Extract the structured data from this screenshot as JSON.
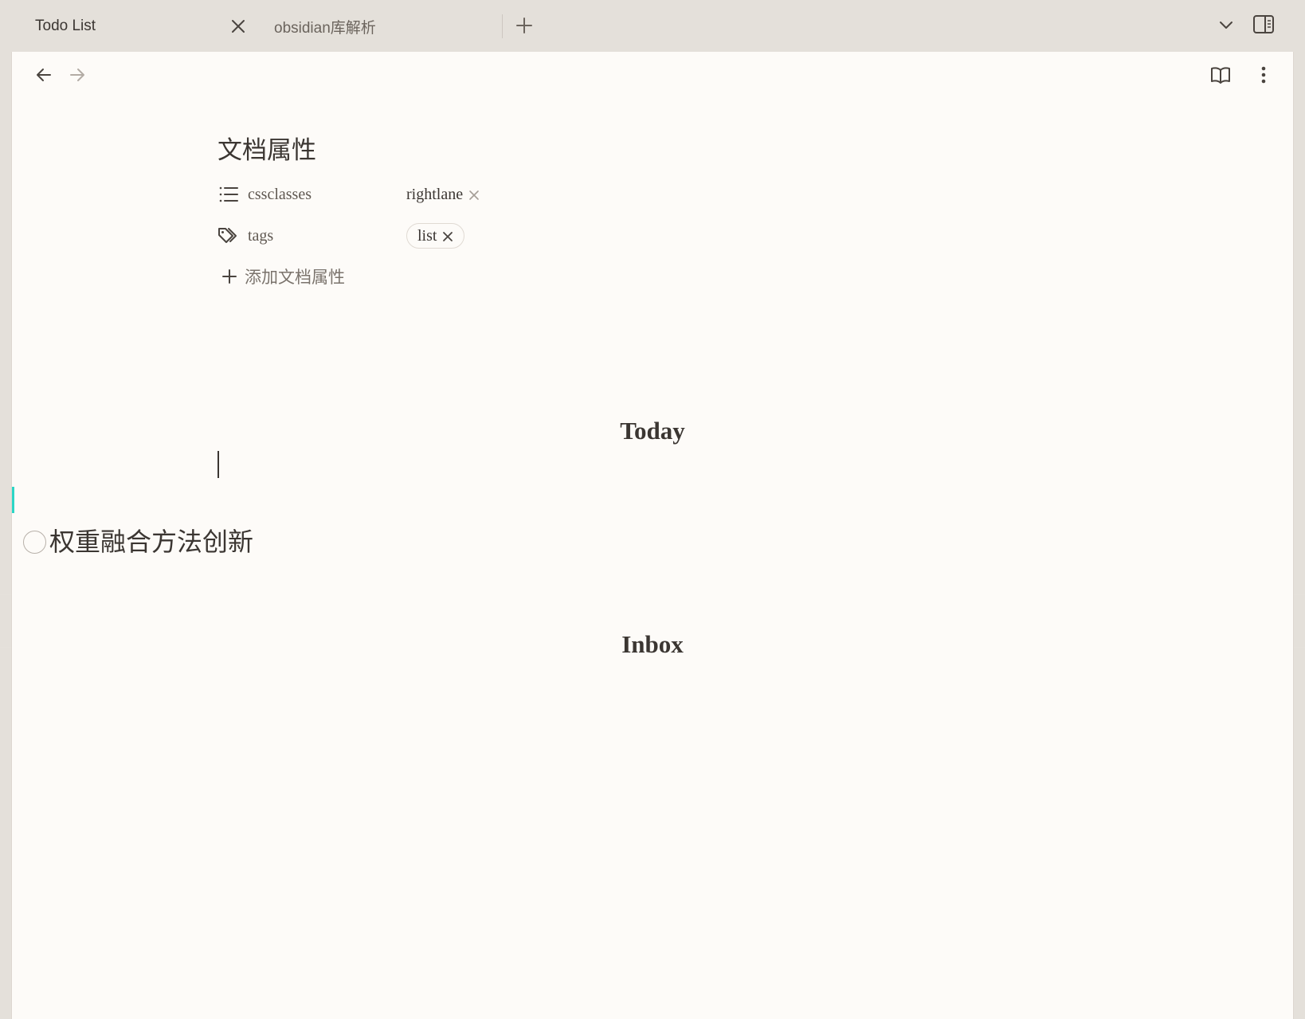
{
  "tabs": [
    {
      "label": "Todo List",
      "active": true
    },
    {
      "label": "obsidian库解析",
      "active": false
    }
  ],
  "properties": {
    "heading": "文档属性",
    "rows": [
      {
        "key": "cssclasses",
        "value": "rightlane",
        "icon": "list-icon"
      },
      {
        "key": "tags",
        "value": "list",
        "icon": "tags-icon"
      }
    ],
    "add_label": "添加文档属性"
  },
  "sections": {
    "today": "Today",
    "inbox": "Inbox"
  },
  "tasks": [
    {
      "text": "权重融合方法创新",
      "done": false
    }
  ],
  "colors": {
    "accent": "#2bd6c6",
    "pane_bg": "#fdfbf8",
    "tabbar_bg": "#e4e0da"
  }
}
